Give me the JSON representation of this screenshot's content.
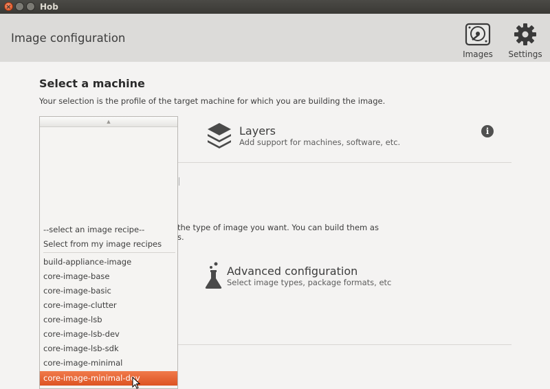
{
  "window": {
    "title": "Hob"
  },
  "header": {
    "title": "Image configuration",
    "images_label": "Images",
    "settings_label": "Settings"
  },
  "machine": {
    "title": "Select a machine",
    "description": "Your selection is the profile of the target machine for which you are building the image."
  },
  "layers": {
    "title": "Layers",
    "subtitle": "Add support for machines, software, etc."
  },
  "recipe_partial": {
    "line1": "the type of image you want. You can build them as",
    "line2": "s."
  },
  "advanced": {
    "title": "Advanced configuration",
    "subtitle": "Select image types, package formats, etc"
  },
  "recipe_dropdown": {
    "header_items": [
      "--select an image recipe--",
      "Select from my image recipes"
    ],
    "items": [
      "build-appliance-image",
      "core-image-base",
      "core-image-basic",
      "core-image-clutter",
      "core-image-lsb",
      "core-image-lsb-dev",
      "core-image-lsb-sdk",
      "core-image-minimal",
      "core-image-minimal-dev"
    ],
    "selected": "core-image-minimal-dev"
  },
  "colors": {
    "highlight": "#dd5322",
    "header_bg": "#dcdbd9",
    "titlebar_bg": "#3a3935"
  }
}
